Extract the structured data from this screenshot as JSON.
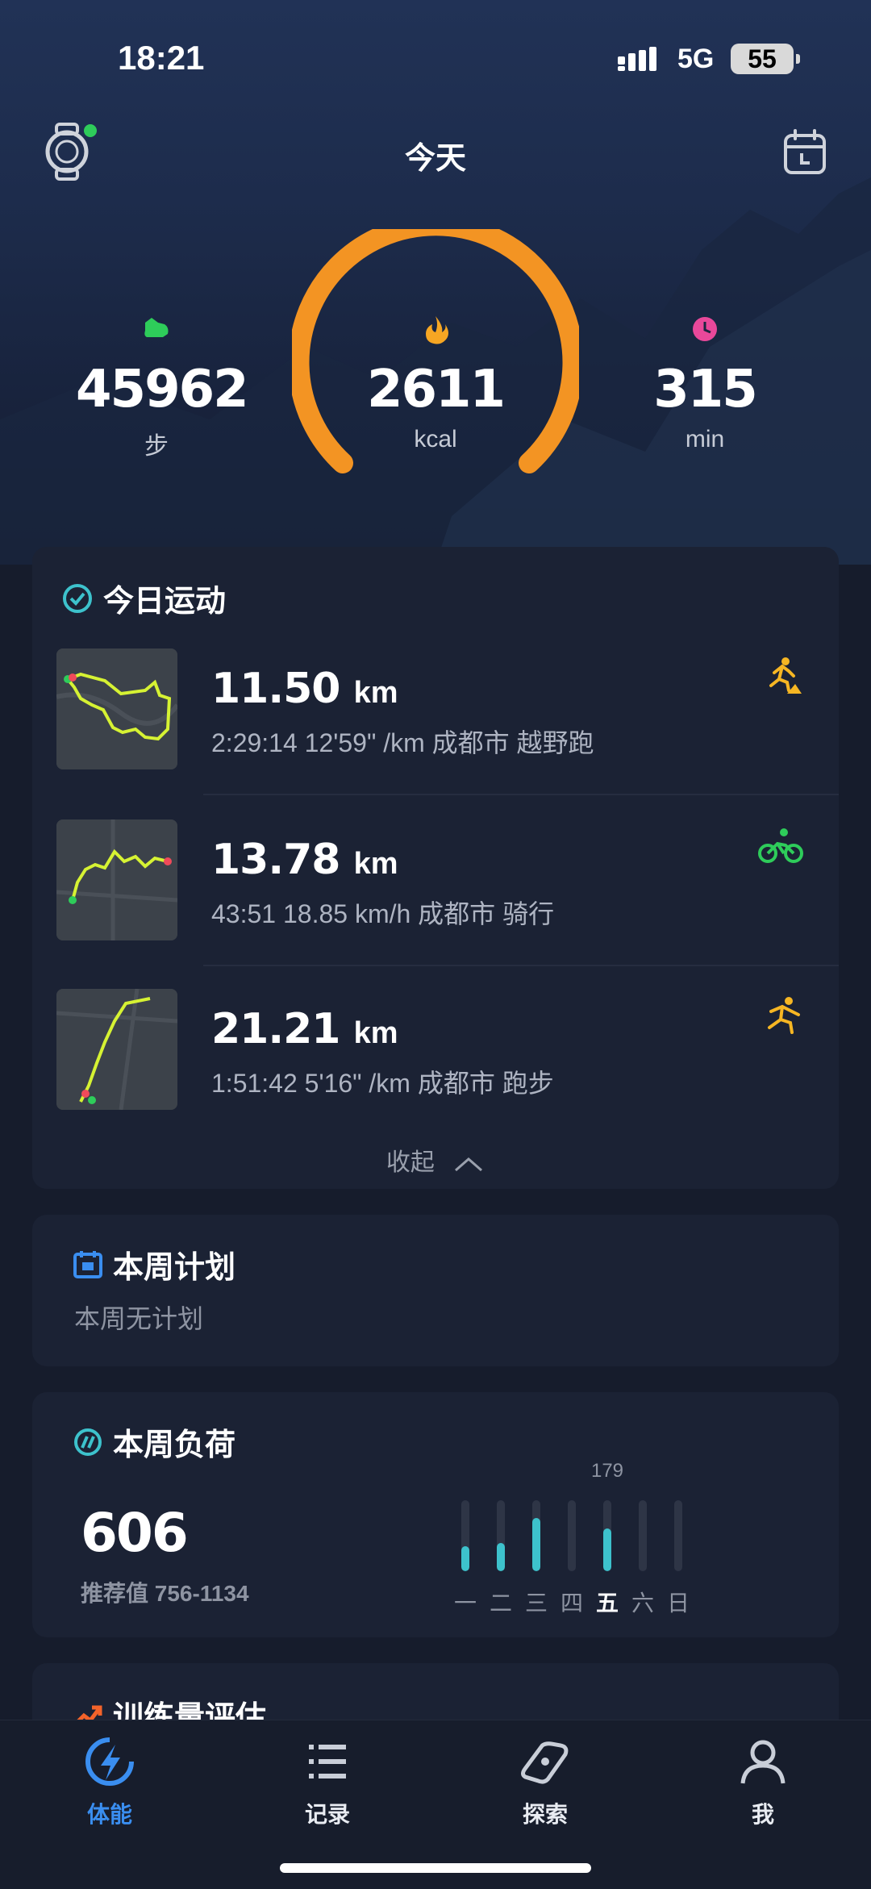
{
  "status_bar": {
    "time": "18:21",
    "network": "5G",
    "battery": "55"
  },
  "header": {
    "title": "今天"
  },
  "summary": {
    "steps": {
      "value": "45962",
      "unit": "步"
    },
    "calories": {
      "value": "2611",
      "unit": "kcal"
    },
    "duration": {
      "value": "315",
      "unit": "min"
    }
  },
  "today": {
    "title": "今日运动",
    "activities": [
      {
        "distance": "11.50",
        "unit": "km",
        "detail": "2:29:14  12'59\" /km 成都市 越野跑",
        "type_icon": "trail-run-icon"
      },
      {
        "distance": "13.78",
        "unit": "km",
        "detail": "43:51  18.85 km/h 成都市 骑行",
        "type_icon": "cycling-icon"
      },
      {
        "distance": "21.21",
        "unit": "km",
        "detail": "1:51:42  5'16\" /km 成都市 跑步",
        "type_icon": "running-icon"
      }
    ],
    "collapse_label": "收起"
  },
  "weekly_plan": {
    "title": "本周计划",
    "empty_text": "本周无计划"
  },
  "weekly_load": {
    "title": "本周负荷",
    "value": "606",
    "recommended": "推荐值 756-1134",
    "highlight_value": "179",
    "days": [
      {
        "label": "一",
        "level": 0.35
      },
      {
        "label": "二",
        "level": 0.4
      },
      {
        "label": "三",
        "level": 0.75
      },
      {
        "label": "四",
        "level": 0
      },
      {
        "label": "五",
        "level": 0.6
      },
      {
        "label": "六",
        "level": 0
      },
      {
        "label": "日",
        "level": 0
      }
    ]
  },
  "training": {
    "title": "训练量评估"
  },
  "tabs": [
    {
      "label": "体能",
      "active": true
    },
    {
      "label": "记录",
      "active": false
    },
    {
      "label": "探索",
      "active": false
    },
    {
      "label": "我",
      "active": false
    }
  ],
  "colors": {
    "accent_orange": "#f39423",
    "accent_blue": "#3a8ef0",
    "teal": "#3dc2cc",
    "track_yellow": "#d6f233"
  }
}
